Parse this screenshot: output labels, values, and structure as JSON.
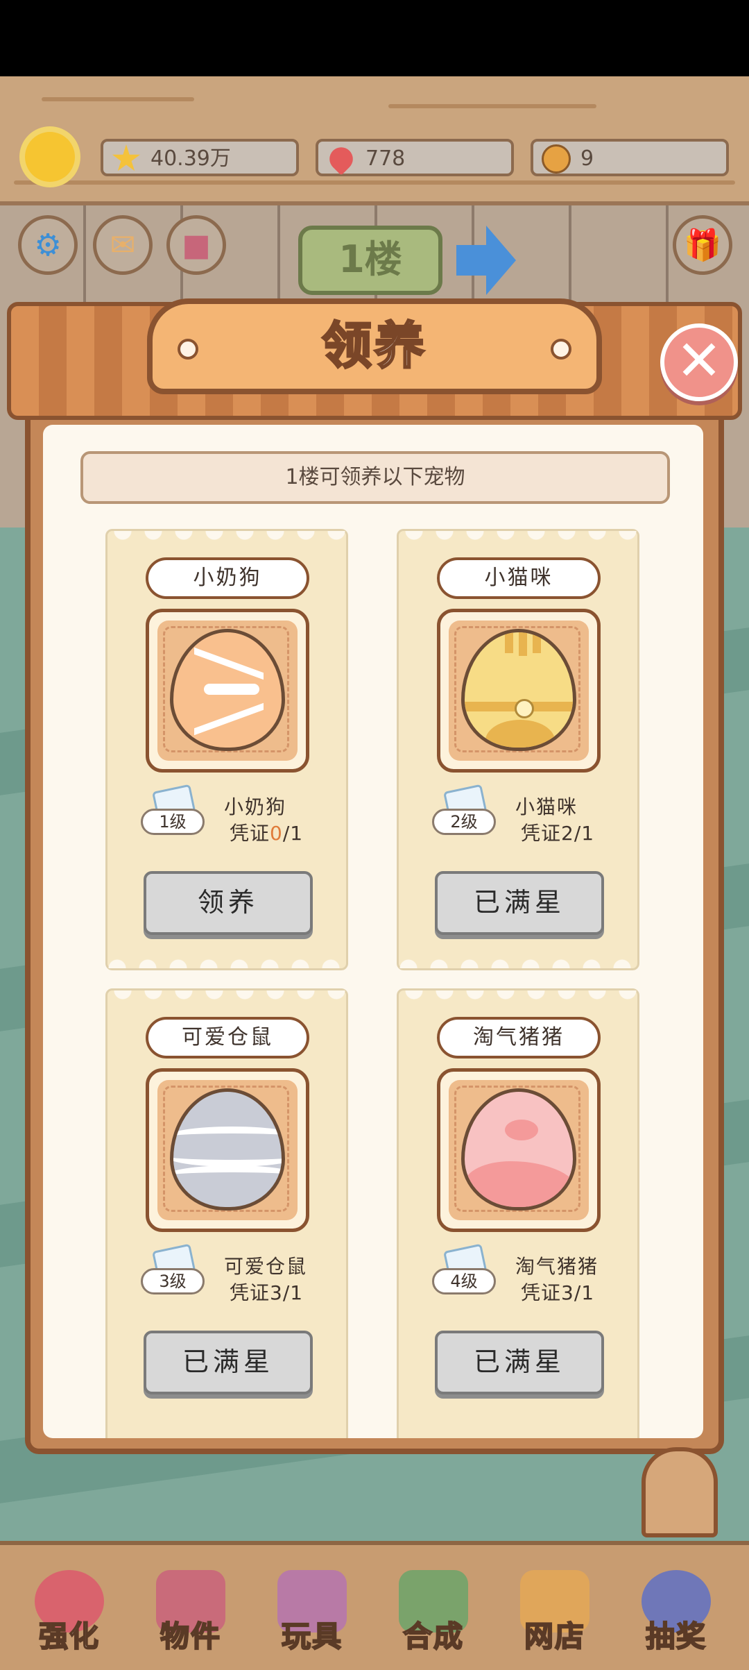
{
  "resources": {
    "stars": "40.39万",
    "hearts": "778",
    "paws": "9"
  },
  "floor_sign": "1楼",
  "dialog": {
    "title": "领养",
    "subtitle": "1楼可领养以下宠物"
  },
  "pets": [
    {
      "tag": "小奶狗",
      "level": "1级",
      "name": "小奶狗",
      "voucher_prefix": "凭证",
      "voucher_current": "0",
      "voucher_total": "/1",
      "button": "领养",
      "egg": "dog",
      "egg_color": "#f9c08e"
    },
    {
      "tag": "小猫咪",
      "level": "2级",
      "name": "小猫咪",
      "voucher_prefix": "凭证",
      "voucher_current": "2",
      "voucher_total": "/1",
      "button": "已满星",
      "egg": "cat",
      "egg_color": "#f7dc86"
    },
    {
      "tag": "可爱仓鼠",
      "level": "3级",
      "name": "可爱仓鼠",
      "voucher_prefix": "凭证",
      "voucher_current": "3",
      "voucher_total": "/1",
      "button": "已满星",
      "egg": "hamster",
      "egg_color": "#c9ccd6"
    },
    {
      "tag": "淘气猪猪",
      "level": "4级",
      "name": "淘气猪猪",
      "voucher_prefix": "凭证",
      "voucher_current": "3",
      "voucher_total": "/1",
      "button": "已满星",
      "egg": "pig",
      "egg_color": "#f8c2c2"
    }
  ],
  "nav": [
    {
      "label": "强化",
      "icon": "lollipop-icon",
      "color": "#d9636d"
    },
    {
      "label": "物件",
      "icon": "piano-icon",
      "color": "#c96b7a"
    },
    {
      "label": "玩具",
      "icon": "cat-house-icon",
      "color": "#b87aa6"
    },
    {
      "label": "合成",
      "icon": "cards-icon",
      "color": "#7aa36b"
    },
    {
      "label": "网店",
      "icon": "basket-icon",
      "color": "#e0a65a"
    },
    {
      "label": "抽奖",
      "icon": "wheel-icon",
      "color": "#6f77b8"
    }
  ]
}
